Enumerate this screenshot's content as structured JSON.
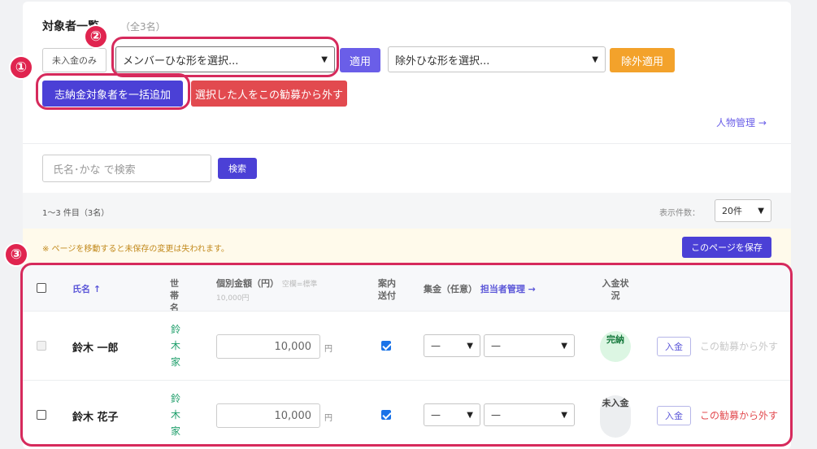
{
  "header": {
    "title": "対象者一覧",
    "count": "（全3名）"
  },
  "toolbar": {
    "unpaid_only_label": "未入金のみ",
    "member_template_select": "メンバーひな形を選択...",
    "apply_label": "適用",
    "exclude_template_select": "除外ひな形を選択...",
    "exclude_apply_label": "除外適用",
    "bulk_add_label": "志納金対象者を一括追加",
    "remove_selected_label": "選択した人をこの勧募から外す",
    "people_link": "人物管理 →"
  },
  "search": {
    "placeholder": "氏名･かな で検索",
    "button_label": "検索"
  },
  "range": {
    "text": "1〜3 件目（3名）",
    "perpage_label": "表示件数：",
    "perpage_value": "20件"
  },
  "warning": {
    "text": "※ ページを移動すると未保存の変更は失われます。",
    "save_label": "このページを保存"
  },
  "table": {
    "headers": {
      "name": "氏名 ↑",
      "household": "世帯名",
      "amount": "個別金額（円）",
      "amount_hint": "空欄=標準",
      "amount_default": "10,000円",
      "notice": "案内送付",
      "collector": "集金（任意）",
      "collector_link": "担当者管理 →",
      "status": "入金状況"
    },
    "rows": [
      {
        "name": "鈴木 一郎",
        "household": "鈴木家",
        "amount": "10,000",
        "yen": "円",
        "notice_sent": true,
        "collector_1": "—",
        "collector_2": "—",
        "status": "完納",
        "deposit_label": "入金",
        "remove_label": "この勧募から外す",
        "remove_enabled": false
      },
      {
        "name": "鈴木 花子",
        "household": "鈴木家",
        "amount": "10,000",
        "yen": "円",
        "notice_sent": true,
        "collector_1": "—",
        "collector_2": "—",
        "status": "未入金",
        "deposit_label": "入金",
        "remove_label": "この勧募から外す",
        "remove_enabled": true
      }
    ]
  },
  "annotations": [
    "①",
    "②",
    "③"
  ],
  "colors": {
    "primary": "#4b40d6",
    "apply": "#6a5ee8",
    "exclude": "#f3a22b",
    "danger": "#e24a4f",
    "highlight": "#d62a5c",
    "household": "#1e9e6a"
  }
}
